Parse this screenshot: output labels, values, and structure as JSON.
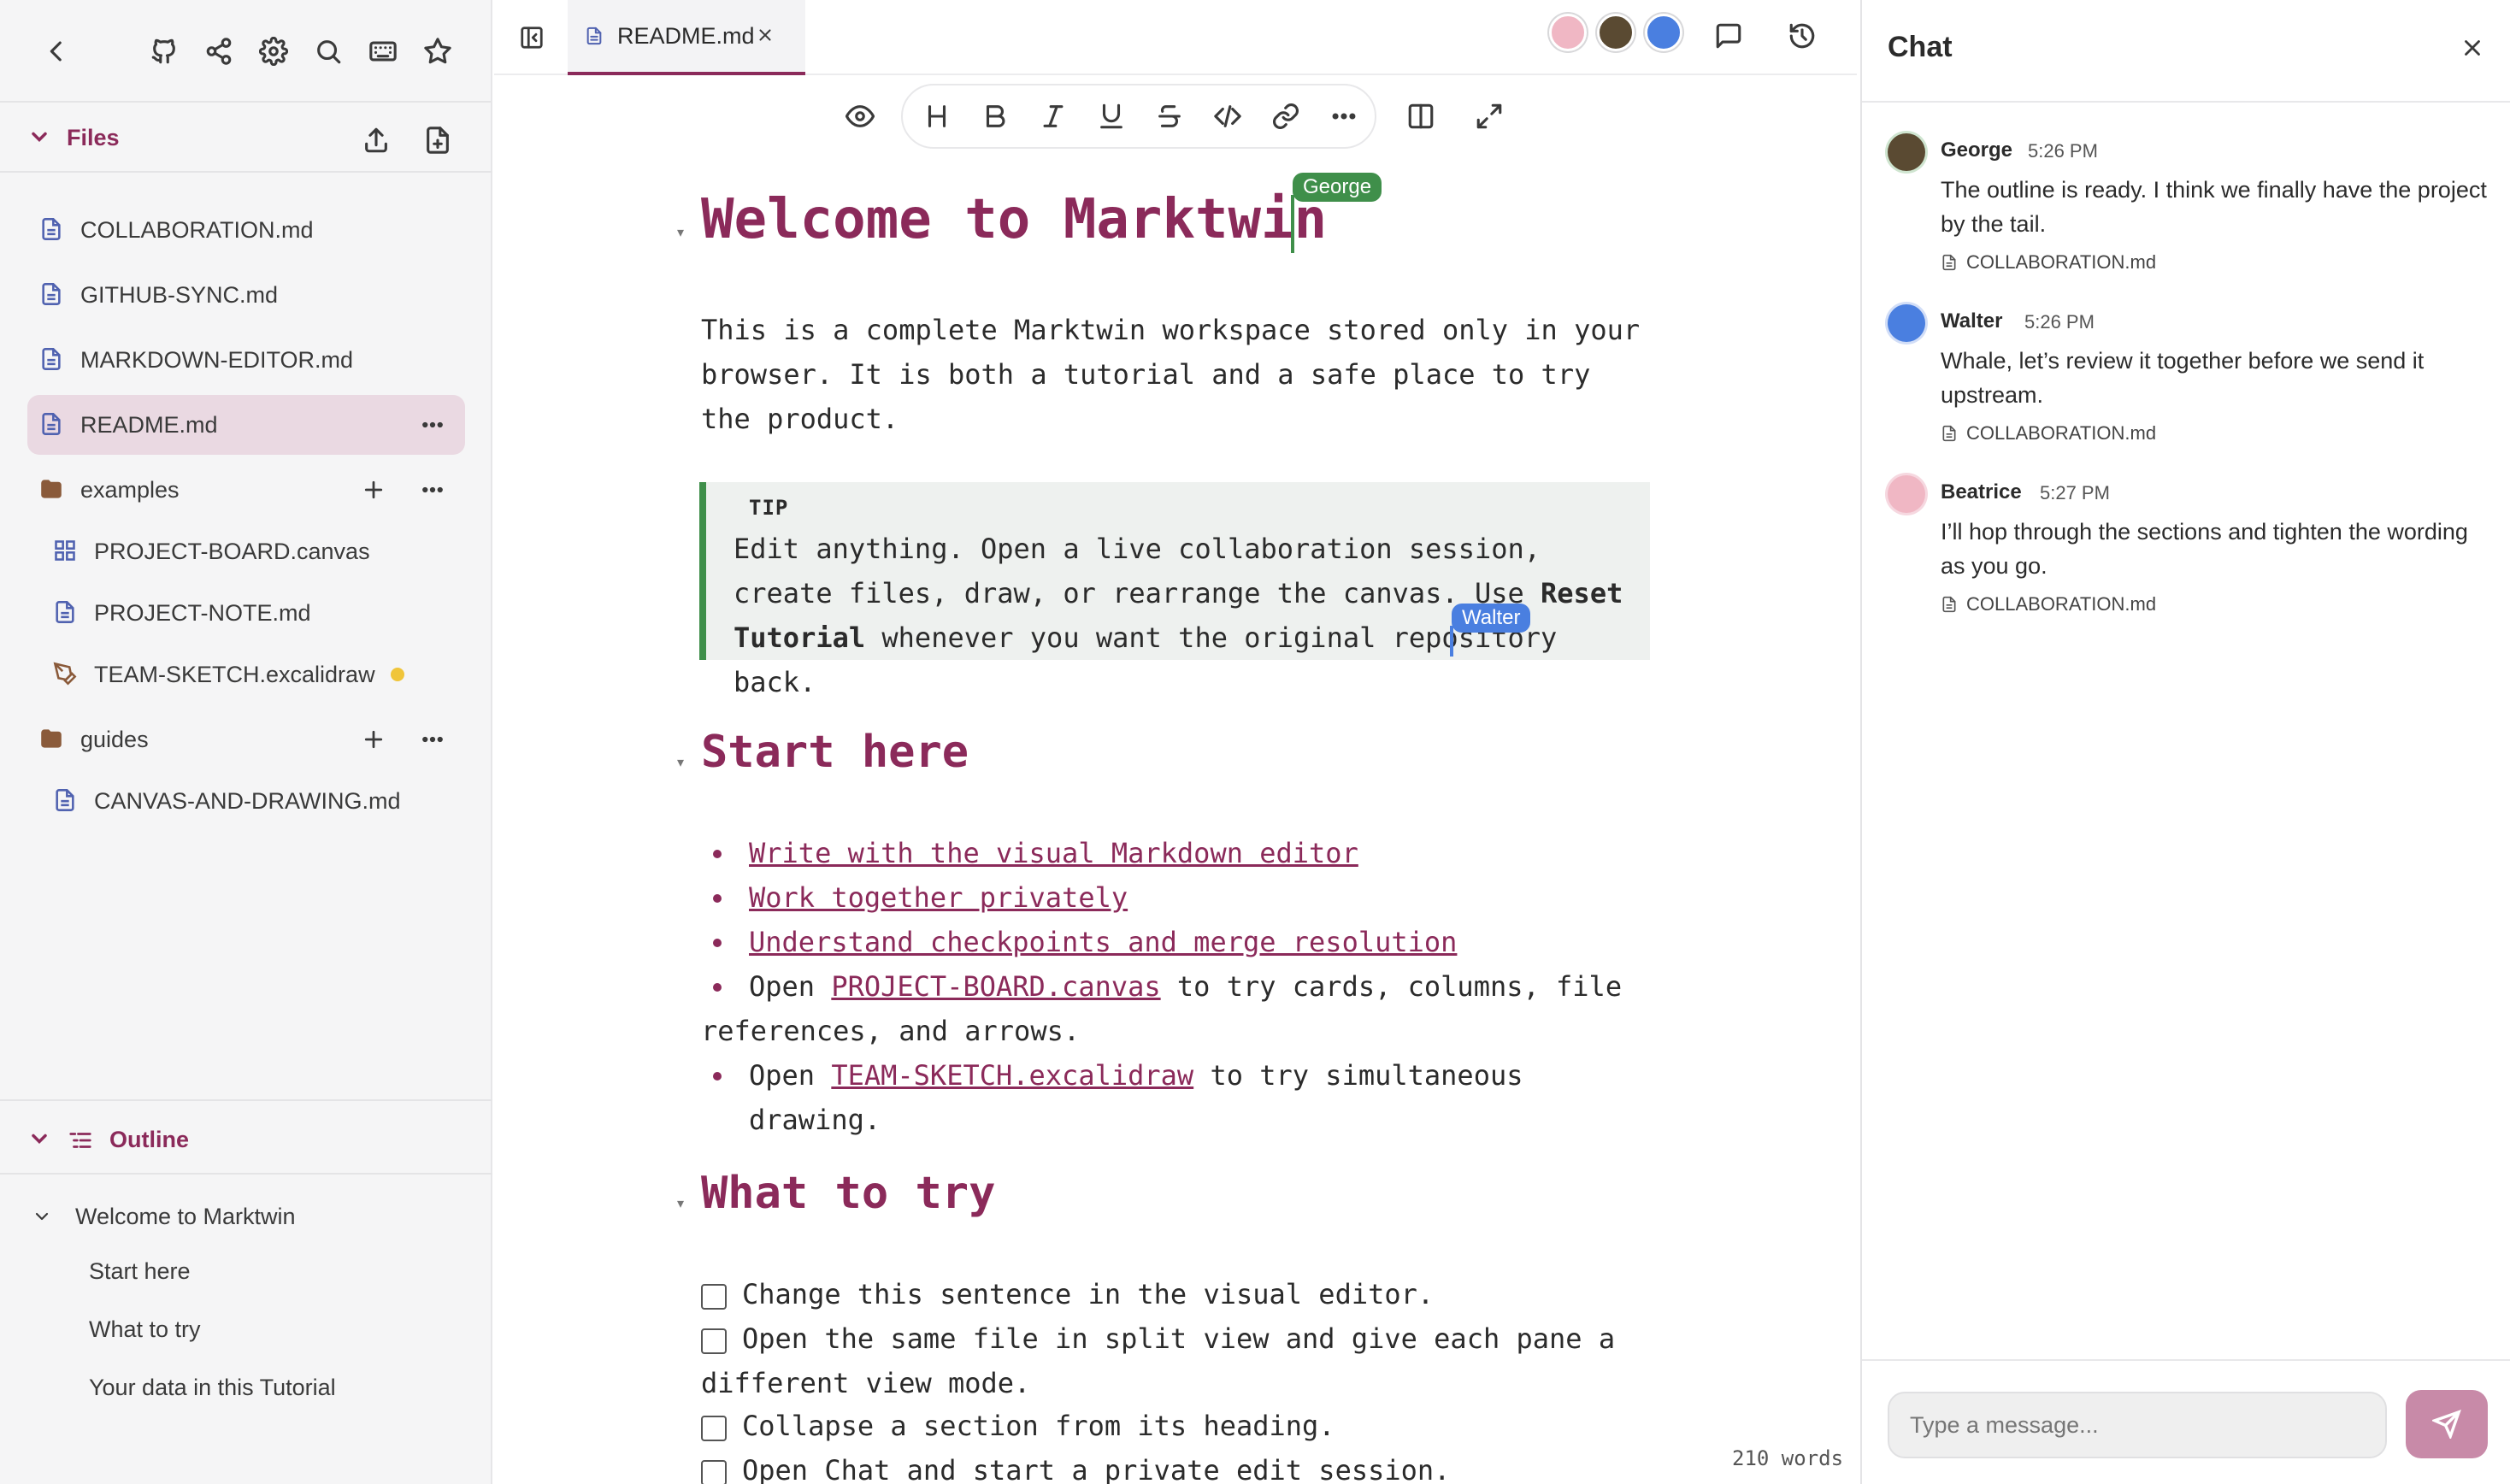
{
  "editor_tab": {
    "name": "README.md"
  },
  "sidebar": {
    "files_title": "Files",
    "files": [
      {
        "name": "COLLABORATION.md",
        "kind": "file"
      },
      {
        "name": "GITHUB-SYNC.md",
        "kind": "file"
      },
      {
        "name": "MARKDOWN-EDITOR.md",
        "kind": "file"
      },
      {
        "name": "README.md",
        "kind": "file",
        "active": true
      },
      {
        "name": "examples",
        "kind": "folder"
      },
      {
        "name": "PROJECT-BOARD.canvas",
        "kind": "canvas"
      },
      {
        "name": "PROJECT-NOTE.md",
        "kind": "file"
      },
      {
        "name": "TEAM-SKETCH.excalidraw",
        "kind": "drawing",
        "dirty": true
      },
      {
        "name": "guides",
        "kind": "folder"
      },
      {
        "name": "CANVAS-AND-DRAWING.md",
        "kind": "file"
      }
    ],
    "outline_title": "Outline",
    "outline": [
      {
        "label": "Welcome to Marktwin",
        "level": 1
      },
      {
        "label": "Start here",
        "level": 2
      },
      {
        "label": "What to try",
        "level": 2
      },
      {
        "label": "Your data in this Tutorial",
        "level": 2
      }
    ]
  },
  "document": {
    "h1": "Welcome to Marktwin",
    "intro": "This is a complete Marktwin workspace stored only in your browser. It is both a tutorial and a safe place to try the product.",
    "tip_label": "TIP",
    "tip_before": "Edit anything. Open a live collaboration session, create files, draw, or rearrange the canvas. Use ",
    "tip_bold": "Reset Tutorial",
    "tip_after": " whenever you want the original repository back.",
    "h2_start": "Start here",
    "links": [
      "Write with the visual Markdown editor",
      "Work together privately",
      "Understand checkpoints and merge resolution"
    ],
    "open_word": "Open",
    "board_link": "PROJECT-BOARD.canvas",
    "board_rest": "to try cards, columns, file",
    "board_rest2": "references, and arrows.",
    "sketch_link": "TEAM-SKETCH.excalidraw",
    "sketch_rest": "to try simultaneous drawing.",
    "h2_try": "What to try",
    "tasks": [
      "Change this sentence in the visual editor.",
      "Open the same file in split view and give each pane a",
      "different view mode.",
      "Collapse a section from its heading.",
      "Open Chat and start a private edit session."
    ],
    "word_count": "210 words"
  },
  "cursors": {
    "george": "George",
    "walter": "Walter"
  },
  "colors": {
    "accent": "#8b2a5a",
    "george": "#3f8f4a",
    "walter": "#4a7fe0",
    "tip_border": "#3f8f4a"
  },
  "chat": {
    "title": "Chat",
    "messages": [
      {
        "author": "George",
        "time": "5:26 PM",
        "text": "The outline is ready. I think we finally have the project by the tail.",
        "file": "COLLABORATION.md"
      },
      {
        "author": "Walter",
        "time": "5:26 PM",
        "text": "Whale, let’s review it together before we send it upstream.",
        "file": "COLLABORATION.md"
      },
      {
        "author": "Beatrice",
        "time": "5:27 PM",
        "text": "I’ll hop through the sections and tighten the wording as you go.",
        "file": "COLLABORATION.md"
      }
    ],
    "input_placeholder": "Type a message..."
  }
}
